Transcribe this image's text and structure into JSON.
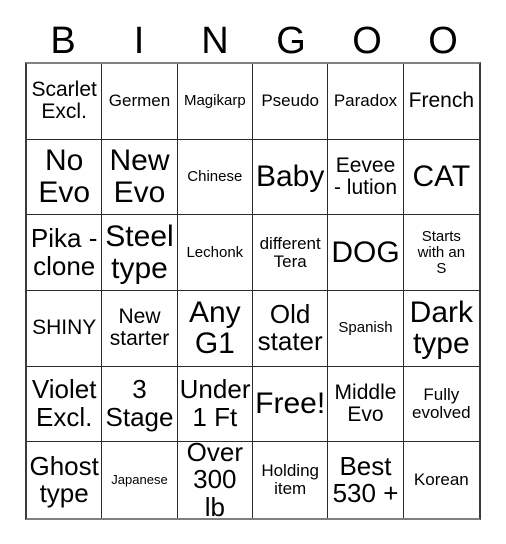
{
  "card": {
    "title": "BINGOO",
    "header_letters": [
      "B",
      "I",
      "N",
      "G",
      "O",
      "O"
    ],
    "columns": 6,
    "rows": 6,
    "border_color": "#2b2b2b",
    "background_color": "#ffffff",
    "text_color": "#000000",
    "free_space_label": "Free!",
    "free_space_position": "row5-col4"
  },
  "cells": [
    {
      "text": "Scarlet\nExcl.",
      "size": "lg"
    },
    {
      "text": "Germen",
      "size": "md"
    },
    {
      "text": "Magikarp",
      "size": "sm"
    },
    {
      "text": "Pseudo",
      "size": "md"
    },
    {
      "text": "Paradox",
      "size": "md"
    },
    {
      "text": "French",
      "size": "lg"
    },
    {
      "text": "No\nEvo",
      "size": "xxl"
    },
    {
      "text": "New\nEvo",
      "size": "xxl"
    },
    {
      "text": "Chinese",
      "size": "sm"
    },
    {
      "text": "Baby",
      "size": "xxl"
    },
    {
      "text": "Eevee\n- lution",
      "size": "lg"
    },
    {
      "text": "CAT",
      "size": "xxl"
    },
    {
      "text": "Pika -\nclone",
      "size": "xl"
    },
    {
      "text": "Steel\ntype",
      "size": "xxl"
    },
    {
      "text": "Lechonk",
      "size": "sm"
    },
    {
      "text": "different\nTera",
      "size": "md"
    },
    {
      "text": "DOG",
      "size": "xxl"
    },
    {
      "text": "Starts\nwith an\nS",
      "size": "sm"
    },
    {
      "text": "SHINY",
      "size": "lg"
    },
    {
      "text": "New\nstarter",
      "size": "lg"
    },
    {
      "text": "Any\nG1",
      "size": "xxl"
    },
    {
      "text": "Old\nstater",
      "size": "xl"
    },
    {
      "text": "Spanish",
      "size": "sm"
    },
    {
      "text": "Dark\ntype",
      "size": "xxl"
    },
    {
      "text": "Violet\nExcl.",
      "size": "xl"
    },
    {
      "text": "3\nStage",
      "size": "xl"
    },
    {
      "text": "Under\n1 Ft",
      "size": "xl"
    },
    {
      "text": "Free!",
      "size": "xxl"
    },
    {
      "text": "Middle\nEvo",
      "size": "lg"
    },
    {
      "text": "Fully\nevolved",
      "size": "md"
    },
    {
      "text": "Ghost\ntype",
      "size": "xl"
    },
    {
      "text": "Japanese",
      "size": "xs"
    },
    {
      "text": "Over\n300 lb",
      "size": "xl"
    },
    {
      "text": "Holding\nitem",
      "size": "md"
    },
    {
      "text": "Best\n530 +",
      "size": "xl"
    },
    {
      "text": "Korean",
      "size": "md"
    }
  ]
}
